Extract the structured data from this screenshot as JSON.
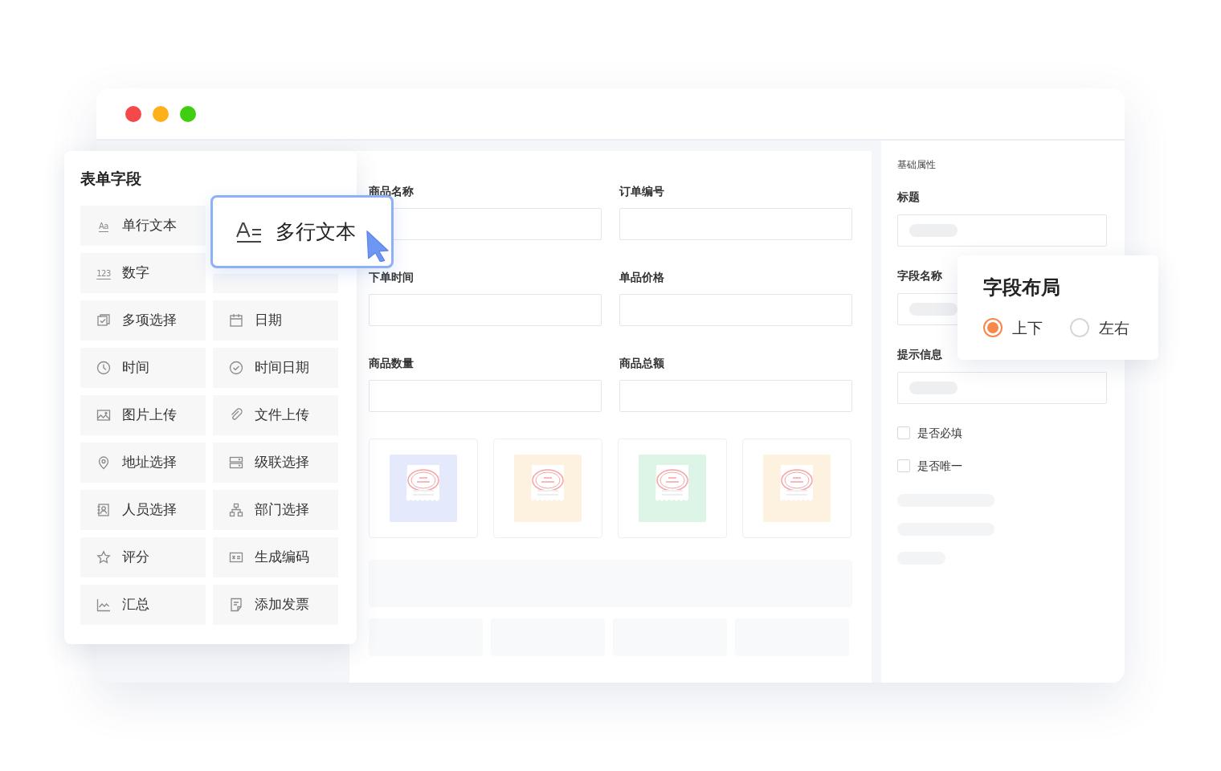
{
  "window": {
    "controls": [
      {
        "color": "#f5484a"
      },
      {
        "color": "#fdb01a"
      },
      {
        "color": "#3fcf10"
      }
    ]
  },
  "field_panel": {
    "title": "表单字段",
    "items": [
      {
        "label": "单行文本",
        "icon_text": "Aa"
      },
      {
        "label": "数字",
        "icon_text": "123"
      },
      {
        "label": "多项选择"
      },
      {
        "label": "日期"
      },
      {
        "label": "时间"
      },
      {
        "label": "时间日期"
      },
      {
        "label": "图片上传"
      },
      {
        "label": "文件上传"
      },
      {
        "label": "地址选择"
      },
      {
        "label": "级联选择"
      },
      {
        "label": "人员选择"
      },
      {
        "label": "部门选择"
      },
      {
        "label": "评分"
      },
      {
        "label": "生成编码"
      },
      {
        "label": "汇总"
      },
      {
        "label": "添加发票"
      }
    ]
  },
  "drag_card": {
    "label": "多行文本"
  },
  "form": {
    "fields": [
      {
        "label": "商品名称"
      },
      {
        "label": "订单编号"
      },
      {
        "label": "下单时间"
      },
      {
        "label": "单品价格"
      },
      {
        "label": "商品数量"
      },
      {
        "label": "商品总额"
      }
    ],
    "images": [
      {
        "color": "#e4eafb"
      },
      {
        "color": "#fdf1e0"
      },
      {
        "color": "#dcf5e6"
      },
      {
        "color": "#fdf1e0"
      }
    ]
  },
  "properties": {
    "section": "基础属性",
    "fields": [
      {
        "label": "标题"
      },
      {
        "label": "字段名称"
      },
      {
        "label": "提示信息"
      }
    ],
    "checkboxes": [
      {
        "label": "是否必填",
        "checked": false
      },
      {
        "label": "是否唯一",
        "checked": false
      }
    ]
  },
  "layout_popover": {
    "title": "字段布局",
    "options": [
      {
        "label": "上下",
        "selected": true
      },
      {
        "label": "左右",
        "selected": false
      }
    ]
  }
}
